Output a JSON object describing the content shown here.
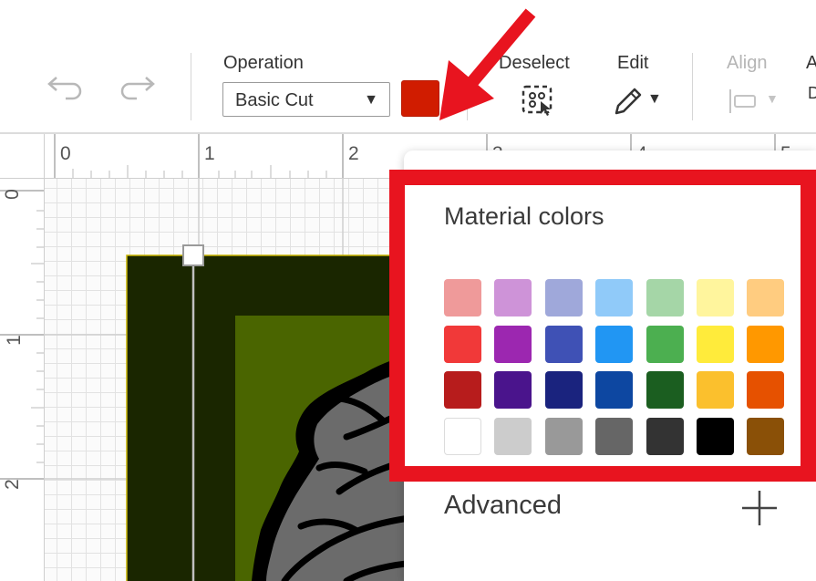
{
  "toolbar": {
    "undo_icon": "undo-icon",
    "redo_icon": "redo-icon",
    "operation_label": "Operation",
    "operation_value": "Basic Cut",
    "operation_caret": "▼",
    "color_swatch": "#d01c00",
    "deselect_label": "Deselect",
    "edit_label": "Edit",
    "edit_caret": "▼",
    "align_label": "Align",
    "align_caret": "▼",
    "arrange_label_partial": "A",
    "arrange_glyph_partial": "D"
  },
  "rulers": {
    "top": [
      "0",
      "1",
      "2",
      "3",
      "4",
      "5"
    ],
    "left": [
      "0",
      "1",
      "2"
    ]
  },
  "popover": {
    "title": "Material colors",
    "colors": [
      [
        "#ef9a9a",
        "#ce93d8",
        "#9fa8da",
        "#90caf9",
        "#a5d6a7",
        "#fff59d",
        "#ffcc80"
      ],
      [
        "#f13939",
        "#9c27b0",
        "#3f51b5",
        "#2196f3",
        "#4caf50",
        "#ffeb3b",
        "#ff9800"
      ],
      [
        "#b71c1c",
        "#4a148c",
        "#1a237e",
        "#0d47a1",
        "#1b5e20",
        "#fbc02d",
        "#e65100"
      ],
      [
        "#ffffff",
        "#cccccc",
        "#999999",
        "#666666",
        "#333333",
        "#000000",
        "#8a5007"
      ]
    ],
    "advanced_label": "Advanced",
    "advanced_icon": "plus-icon"
  },
  "annotation": {
    "arrow_color": "#e8141f",
    "box_color": "#e8141f"
  },
  "design": {
    "frame_color": "#1a2600",
    "inner_color": "#4a6500",
    "shape_color": "#6b6b6b",
    "branch_color": "#000000"
  }
}
